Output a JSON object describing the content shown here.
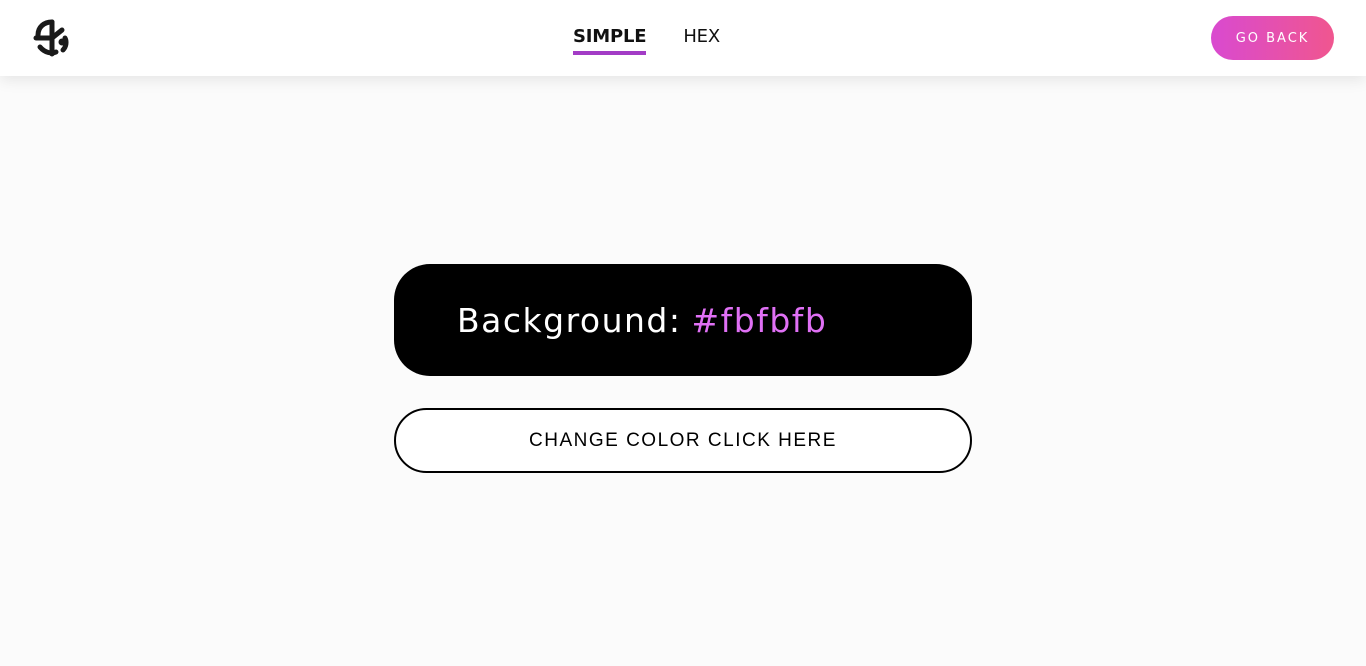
{
  "nav": {
    "links": [
      {
        "label": "SIMPLE",
        "active": true
      },
      {
        "label": "HEX",
        "active": false
      }
    ],
    "go_back_label": "GO BACK",
    "accent_color": "#a33cc6",
    "button_gradient": [
      "#d94ad0",
      "#f0568f"
    ]
  },
  "logo": {
    "icon": "pinwheel-logo-icon"
  },
  "main": {
    "background_label": "Background:",
    "background_value": "#fbfbfb",
    "change_button_label": "CHANGE COLOR CLICK HERE",
    "card_color": "#000000",
    "value_color": "#e070f5"
  }
}
